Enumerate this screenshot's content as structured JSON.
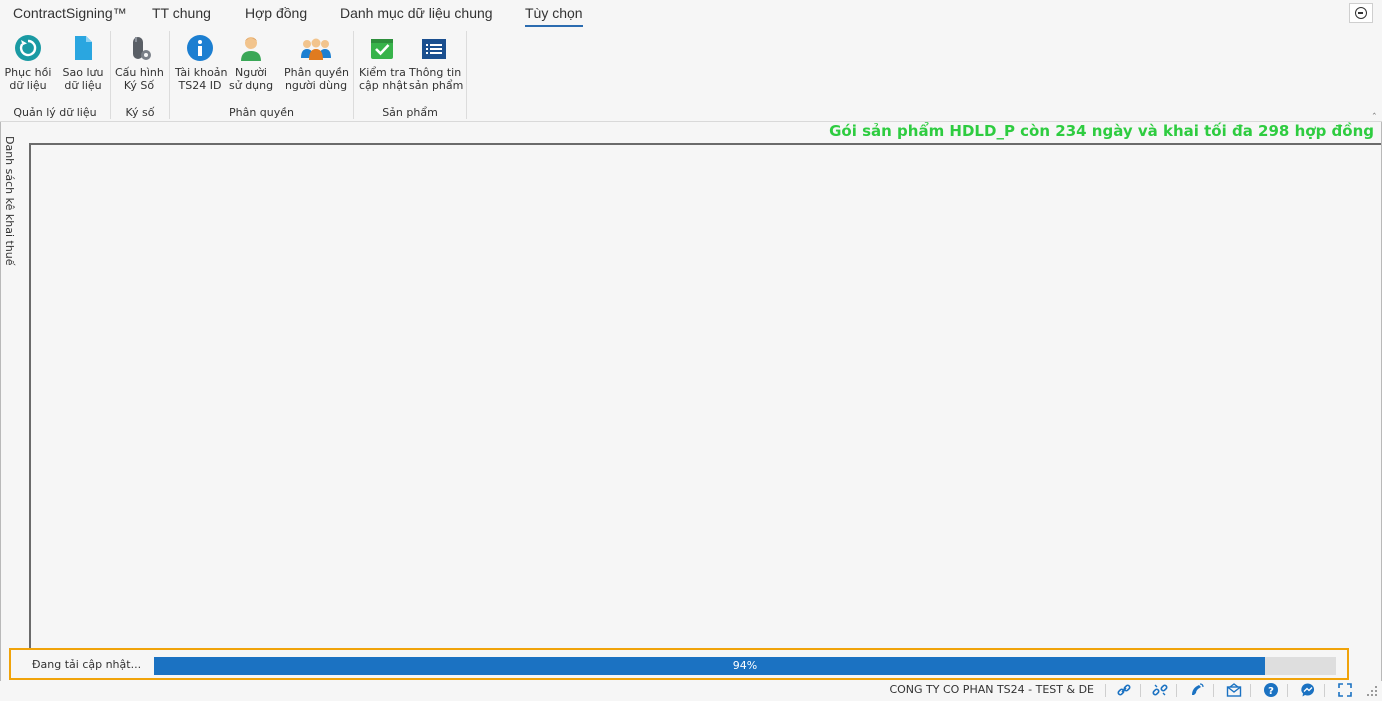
{
  "tabs": {
    "app": "ContractSigning™",
    "general": "TT chung",
    "contract": "Hợp đồng",
    "catalog": "Danh mục dữ liệu chung",
    "options": "Tùy chọn"
  },
  "ribbon": {
    "restore": {
      "line1": "Phục hồi",
      "line2": "dữ liệu"
    },
    "backup": {
      "line1": "Sao lưu",
      "line2": "dữ liệu"
    },
    "config_sign": {
      "line1": "Cấu hình",
      "line2": "Ký Số"
    },
    "account": {
      "line1": "Tài khoản",
      "line2": "TS24 ID"
    },
    "user": {
      "line1": "Người",
      "line2": "sử dụng"
    },
    "permission": {
      "line1": "Phân quyền",
      "line2": "người dùng"
    },
    "check_update": {
      "line1": "Kiểm tra",
      "line2": "cập nhật"
    },
    "product_info": {
      "line1": "Thông tin",
      "line2": "sản phẩm"
    },
    "groups": {
      "data": "Quản lý dữ liệu",
      "sign": "Ký số",
      "perm": "Phân quyền",
      "product": "Sản phẩm"
    }
  },
  "notice": "Gói sản phẩm HDLD_P còn 234 ngày và khai tối đa 298 hợp đồng",
  "side_tab": "Danh sách kê khai thuế",
  "progress": {
    "label": "Đang tải cập nhật...",
    "value": 0.94,
    "text": "94%"
  },
  "status": {
    "company": "CONG TY CO PHAN TS24 - TEST & DE"
  },
  "colors": {
    "accent": "#1b72c2",
    "notice": "#2ecc40",
    "highlight": "#f0a30a"
  }
}
